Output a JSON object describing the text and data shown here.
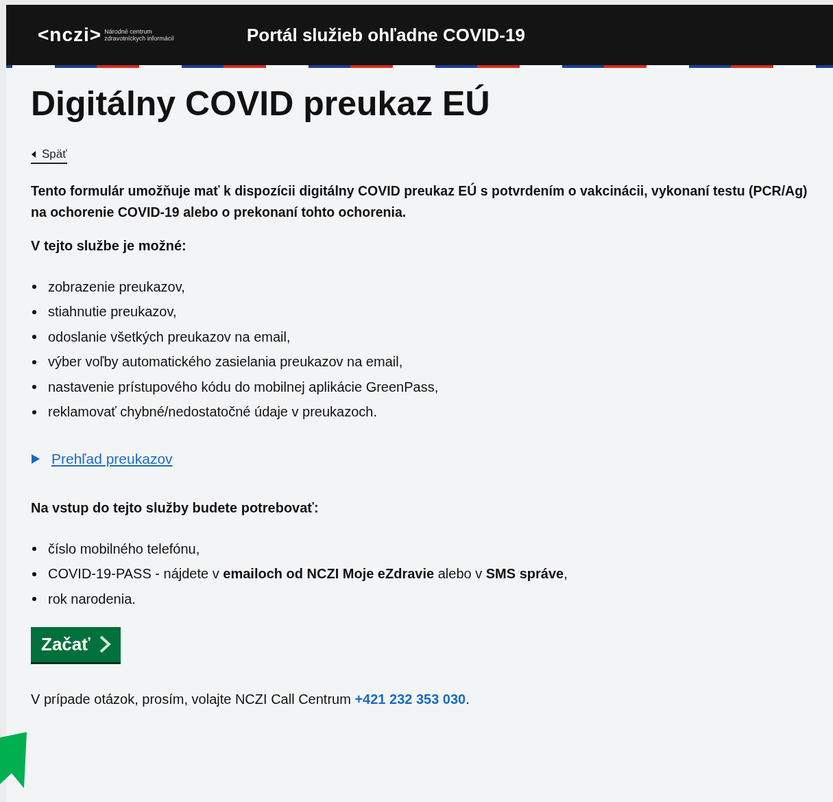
{
  "header": {
    "logo": "<nczi>",
    "logo_subtitle": "Národné centrum zdravotníckych informácií",
    "title": "Portál služieb ohľadne COVID-19"
  },
  "page_title": "Digitálny COVID preukaz EÚ",
  "back_link": "Späť",
  "intro": "Tento formulár umožňuje mať k dispozícii digitálny COVID preukaz EÚ s potvrdením o vakcinácii, vykonaní testu (PCR/Ag) na ochorenie COVID-19 alebo o prekonaní tohto ochorenia.",
  "services_heading": "V tejto službe je možné:",
  "services": [
    "zobrazenie preukazov,",
    "stiahnutie preukazov,",
    "odoslanie všetkých preukazov na email,",
    "výber voľby automatického zasielania preukazov na email,",
    "nastavenie prístupového kódu do mobilnej aplikácie GreenPass,",
    "reklamovať chybné/nedostatočné údaje v preukazoch."
  ],
  "overview": {
    "label": "Prehľad preukazov",
    "expanded": false
  },
  "requirements_heading": "Na vstup do tejto služby budete potrebovať:",
  "requirements": [
    "číslo mobilného telefónu,",
    "COVID-19-PASS - nájdete v **emailoch od NCZI Moje eZdravie** alebo v **SMS správe**,",
    "rok narodenia."
  ],
  "start_button": "Začať",
  "contact": {
    "text": "V prípade otázok, prosím, volajte NCZI Call Centrum",
    "phone": "+421 232 353 030",
    "end": "."
  }
}
